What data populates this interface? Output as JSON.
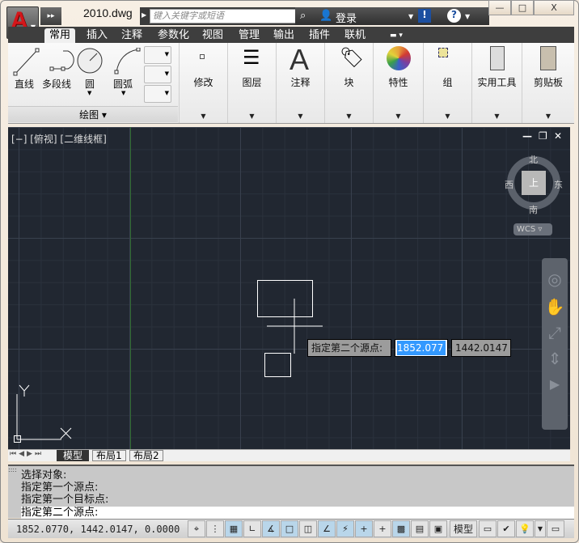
{
  "app": {
    "title": "2010.dwg",
    "logo_letter": "A"
  },
  "search": {
    "placeholder": "键入关键字或短语"
  },
  "infocenter": {
    "login": "登录"
  },
  "window_controls": {
    "minimize": "—",
    "maximize": "□",
    "close": "X"
  },
  "ribbon_tabs": [
    "常用",
    "插入",
    "注释",
    "参数化",
    "视图",
    "管理",
    "输出",
    "插件",
    "联机"
  ],
  "active_tab": "常用",
  "draw_panel": {
    "title": "绘图",
    "tools": [
      "直线",
      "多段线",
      "圆",
      "圆弧"
    ]
  },
  "panels": [
    "修改",
    "图层",
    "注释",
    "块",
    "特性",
    "组",
    "实用工具",
    "剪贴板"
  ],
  "viewport": {
    "label": "[−] [俯视] [二维线框]",
    "controls": {
      "minimize": "—",
      "restore": "❐",
      "close": "✕"
    },
    "viewcube": {
      "north": "北",
      "south": "南",
      "east": "东",
      "west": "西",
      "face": "上"
    },
    "ucs": "WCS",
    "axis_x": "X",
    "axis_y": "Y"
  },
  "dynamic_input": {
    "prompt": "指定第二个源点:",
    "x_value": "1852.077",
    "y_value": "1442.0147"
  },
  "layout_tabs": [
    "模型",
    "布局1",
    "布局2"
  ],
  "command_history": [
    "选择对象:",
    "指定第一个源点:",
    "指定第一个目标点:"
  ],
  "command_prompt": "指定第二个源点:",
  "status": {
    "coordinates": "1852.0770, 1442.0147, 0.0000",
    "model_label": "模型"
  },
  "colors": {
    "viewport_bg": "#212731",
    "highlight": "#3399ff",
    "accent_red": "#d4161a"
  }
}
